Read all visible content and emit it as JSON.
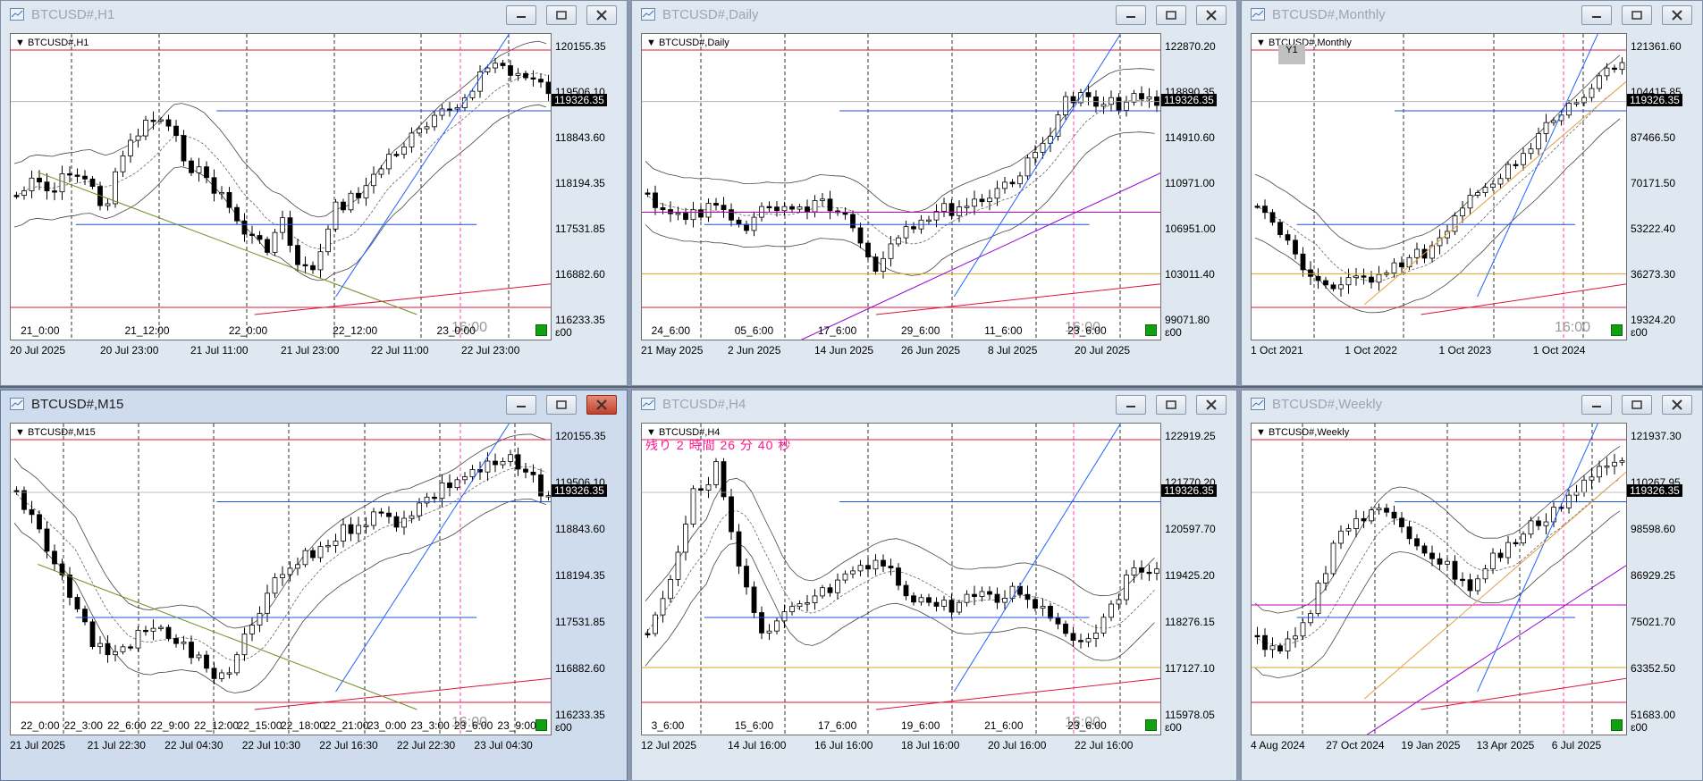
{
  "windows": [
    {
      "title": "BTCUSD#,H1",
      "chart_label": "BTCUSD#,H1",
      "active": false,
      "price_label": "119326.35",
      "y_ticks": [
        "120155.35",
        "119506.10",
        "118843.60",
        "118194.35",
        "117531.85",
        "116882.60",
        "116233.35"
      ],
      "x_ticks_top": [
        "21_0:00",
        "21_12:00",
        "22_0:00",
        "22_12:00",
        "23_0:00"
      ],
      "x_ticks_bottom": [
        "20 Jul 2025",
        "20 Jul 23:00",
        "21 Jul 11:00",
        "21 Jul 23:00",
        "22 Jul 11:00",
        "22 Jul 23:00"
      ],
      "time_marker": "16:00",
      "axis_small": "2",
      "axis_small_e": "ɛ00"
    },
    {
      "title": "BTCUSD#,Daily",
      "chart_label": "BTCUSD#,Daily",
      "active": false,
      "price_label": "119326.35",
      "y_ticks": [
        "122870.20",
        "118890.35",
        "114910.60",
        "110971.00",
        "106951.00",
        "103011.40",
        "99071.80"
      ],
      "x_ticks_top": [
        "24_6:00",
        "05_6:00",
        "17_6:00",
        "29_6:00",
        "11_6:00",
        "23_6:00"
      ],
      "x_ticks_bottom": [
        "21 May 2025",
        "2 Jun 2025",
        "14 Jun 2025",
        "26 Jun 2025",
        "8 Jul 2025",
        "20 Jul 2025"
      ],
      "time_marker": "16:00",
      "axis_small": "2",
      "axis_small_e": "ɛ00"
    },
    {
      "title": "BTCUSD#,Monthly",
      "chart_label": "BTCUSD#,Monthly",
      "active": false,
      "price_label": "119326.35",
      "y_ticks": [
        "121361.60",
        "104415.85",
        "87466.50",
        "70171.50",
        "53222.40",
        "36273.30",
        "19324.20"
      ],
      "x_ticks_top": [],
      "x_ticks_bottom": [
        "1 Oct 2021",
        "1 Oct 2022",
        "1 Oct 2023",
        "1 Oct 2024"
      ],
      "time_marker": "16:00",
      "axis_small": "2",
      "axis_small_e": "ɛ00",
      "mini_badge": "Y1"
    },
    {
      "title": "BTCUSD#,M15",
      "chart_label": "BTCUSD#,M15",
      "active": true,
      "price_label": "119326.35",
      "y_ticks": [
        "120155.35",
        "119506.10",
        "118843.60",
        "118194.35",
        "117531.85",
        "116882.60",
        "116233.35"
      ],
      "x_ticks_top": [
        "22_0:00",
        "22_3:00",
        "22_6:00",
        "22_9:00",
        "22_12:00",
        "22_15:00",
        "22_18:00",
        "22_21:00",
        "23_0:00",
        "23_3:00",
        "23_6:00",
        "23_9:00"
      ],
      "x_ticks_bottom": [
        "21 Jul 2025",
        "21 Jul 22:30",
        "22 Jul 04:30",
        "22 Jul 10:30",
        "22 Jul 16:30",
        "22 Jul 22:30",
        "23 Jul 04:30"
      ],
      "time_marker": "16:00",
      "axis_small": "2",
      "axis_small_e": "ɛ00"
    },
    {
      "title": "BTCUSD#,H4",
      "chart_label": "BTCUSD#,H4",
      "active": false,
      "price_label": "119326.35",
      "countdown": "残り 2 時間 26 分 40 秒",
      "y_ticks": [
        "122919.25",
        "121770.20",
        "120597.70",
        "119425.20",
        "118276.15",
        "117127.10",
        "115978.05"
      ],
      "x_ticks_top": [
        "3_6:00",
        "15_6:00",
        "17_6:00",
        "19_6:00",
        "21_6:00",
        "23_6:00"
      ],
      "x_ticks_bottom": [
        "12 Jul 2025",
        "14 Jul 16:00",
        "16 Jul 16:00",
        "18 Jul 16:00",
        "20 Jul 16:00",
        "22 Jul 16:00"
      ],
      "time_marker": "16:00",
      "axis_small": "2",
      "axis_small_e": "ɛ00"
    },
    {
      "title": "BTCUSD#,Weekly",
      "chart_label": "BTCUSD#,Weekly",
      "active": false,
      "price_label": "119326.35",
      "y_ticks": [
        "121937.30",
        "110267.95",
        "98598.60",
        "86929.25",
        "75021.70",
        "63352.50",
        "51683.00"
      ],
      "x_ticks_top": [],
      "x_ticks_bottom": [
        "4 Aug 2024",
        "27 Oct 2024",
        "19 Jan 2025",
        "13 Apr 2025",
        "6 Jul 2025"
      ],
      "time_marker": "",
      "axis_small": "2",
      "axis_small_e": "ɛ00"
    }
  ]
}
